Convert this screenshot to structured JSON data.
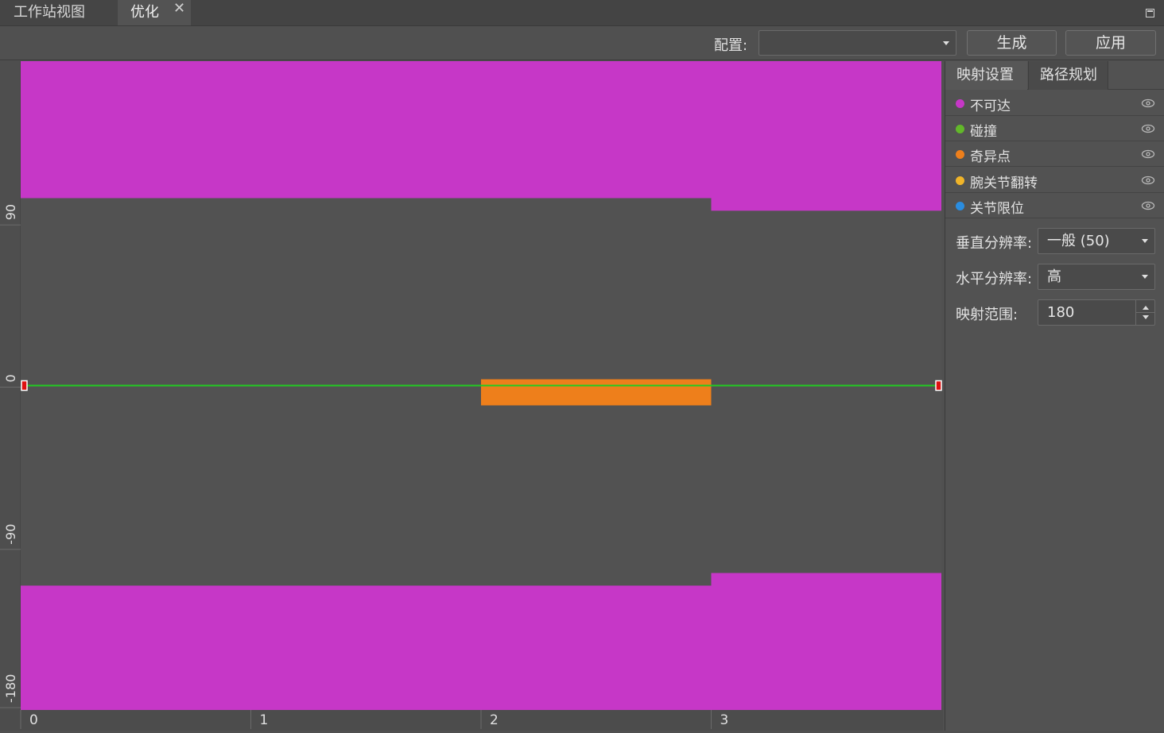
{
  "tabs": {
    "workstation_label": "工作站视图",
    "optimize_label": "优化",
    "close_glyph": "✕"
  },
  "toolbar": {
    "config_label": "配置:",
    "config_value": "",
    "generate_label": "生成",
    "apply_label": "应用"
  },
  "panel": {
    "tab_mapping": "映射设置",
    "tab_path": "路径规划",
    "layers": [
      {
        "label": "不可达",
        "color": "#c637c7"
      },
      {
        "label": "碰撞",
        "color": "#62b82a"
      },
      {
        "label": "奇异点",
        "color": "#ee7f1b"
      },
      {
        "label": "腕关节翻转",
        "color": "#f0b429"
      },
      {
        "label": "关节限位",
        "color": "#2a8de0"
      }
    ],
    "vertical_resolution_label": "垂直分辨率:",
    "vertical_resolution_value": "一般 (50)",
    "horizontal_resolution_label": "水平分辨率:",
    "horizontal_resolution_value": "高",
    "mapping_range_label": "映射范围:",
    "mapping_range_value": "180"
  },
  "chart_data": {
    "type": "heatmap",
    "x_ticks": [
      "0",
      "1",
      "2",
      "3"
    ],
    "y_ticks": [
      "90",
      "0",
      "-90",
      "-180"
    ],
    "xlim": [
      0,
      4
    ],
    "ylim": [
      -180,
      180
    ],
    "regions": [
      {
        "layer": "不可达",
        "color": "#c637c7",
        "x0": 0,
        "x1": 3,
        "y0": 104,
        "y1": 180
      },
      {
        "layer": "不可达",
        "color": "#c637c7",
        "x0": 3,
        "x1": 4,
        "y0": 97,
        "y1": 180
      },
      {
        "layer": "不可达",
        "color": "#c637c7",
        "x0": 0,
        "x1": 3,
        "y0": -180,
        "y1": -111
      },
      {
        "layer": "不可达",
        "color": "#c637c7",
        "x0": 3,
        "x1": 4,
        "y0": -180,
        "y1": -104
      },
      {
        "layer": "奇异点",
        "color": "#ee7f1b",
        "x0": 2,
        "x1": 3,
        "y0": -11,
        "y1": 3.5
      }
    ],
    "path": {
      "color": "#22cc22",
      "points": [
        [
          0,
          0
        ],
        [
          4,
          0
        ]
      ]
    }
  }
}
